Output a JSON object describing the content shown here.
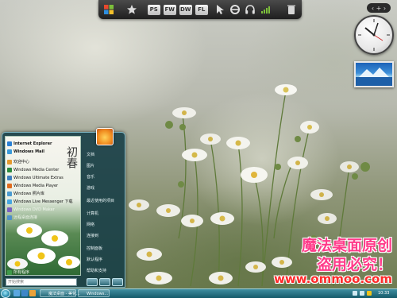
{
  "dock": {
    "items": [
      {
        "name": "windows-logo-icon"
      },
      {
        "name": "star-icon"
      },
      {
        "label": "PS"
      },
      {
        "label": "FW"
      },
      {
        "label": "DW"
      },
      {
        "label": "FL"
      },
      {
        "name": "cursor-icon"
      },
      {
        "name": "ie-icon"
      },
      {
        "name": "headphones-icon"
      },
      {
        "name": "signal-icon"
      },
      {
        "name": "recycle-bin-icon"
      }
    ]
  },
  "start_menu": {
    "pinned": [
      {
        "label": "Internet Explorer",
        "color": "#2a7fd4"
      },
      {
        "label": "Windows Mail",
        "color": "#3a9ad9"
      }
    ],
    "recent": [
      {
        "label": "欢迎中心",
        "color": "#e59a2e"
      },
      {
        "label": "Windows Media Center",
        "color": "#2b8a3e"
      },
      {
        "label": "Windows Ultimate Extras",
        "color": "#3f7fbf"
      },
      {
        "label": "Windows Media Player",
        "color": "#e06b1e"
      },
      {
        "label": "Windows 照片库",
        "color": "#4b9bd1"
      },
      {
        "label": "Windows Live Messenger 下载",
        "color": "#46a6e0"
      },
      {
        "label": "Windows DVD Maker",
        "color": "#7a5fc0"
      },
      {
        "label": "远程桌面连接",
        "color": "#4e8fc9"
      },
      {
        "label": "所有程序",
        "color": "#3f9a4a"
      }
    ],
    "right": [
      "文档",
      "图片",
      "音乐",
      "游戏",
      "最近使用的项目",
      "计算机",
      "网络",
      "连接到",
      "控制面板",
      "默认程序",
      "帮助和支持"
    ],
    "logo_text": "初春",
    "search_placeholder": "开始搜索"
  },
  "taskbar": {
    "tasks": [
      "魔法桌面 - 美化...",
      "Windows..."
    ],
    "clock": "10:33"
  },
  "watermark": {
    "line1": "魔法桌面原创",
    "line2": "盗用必究！",
    "line3": "www.ommoo.com"
  }
}
